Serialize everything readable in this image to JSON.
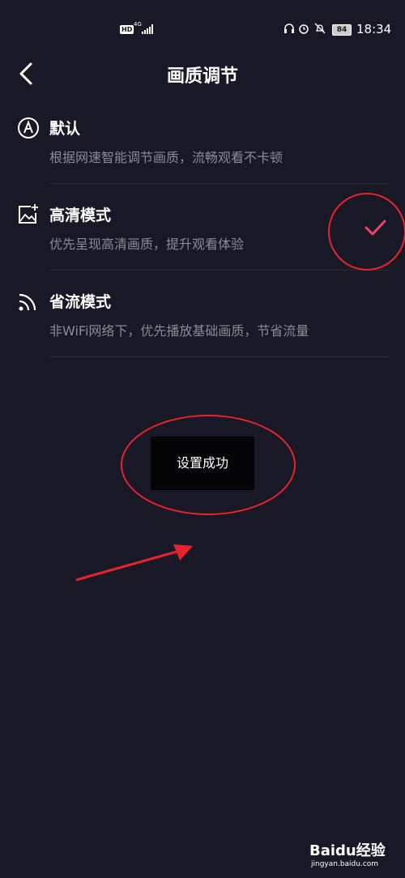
{
  "status_bar": {
    "hd": "HD",
    "network": "4G",
    "battery": "84",
    "time": "18:34"
  },
  "header": {
    "title": "画质调节"
  },
  "options": [
    {
      "title": "默认",
      "description": "根据网速智能调节画质，流畅观看不卡顿",
      "selected": false
    },
    {
      "title": "高清模式",
      "description": "优先呈现高清画质，提升观看体验",
      "selected": true
    },
    {
      "title": "省流模式",
      "description": "非WiFi网络下，优先播放基础画质，节省流量",
      "selected": false
    }
  ],
  "toast": {
    "message": "设置成功"
  },
  "watermark": {
    "brand": "Baidu经验",
    "url": "jingyan.baidu.com"
  },
  "colors": {
    "background": "#181826",
    "accent": "#f0426a",
    "annotation": "#e8232a"
  }
}
